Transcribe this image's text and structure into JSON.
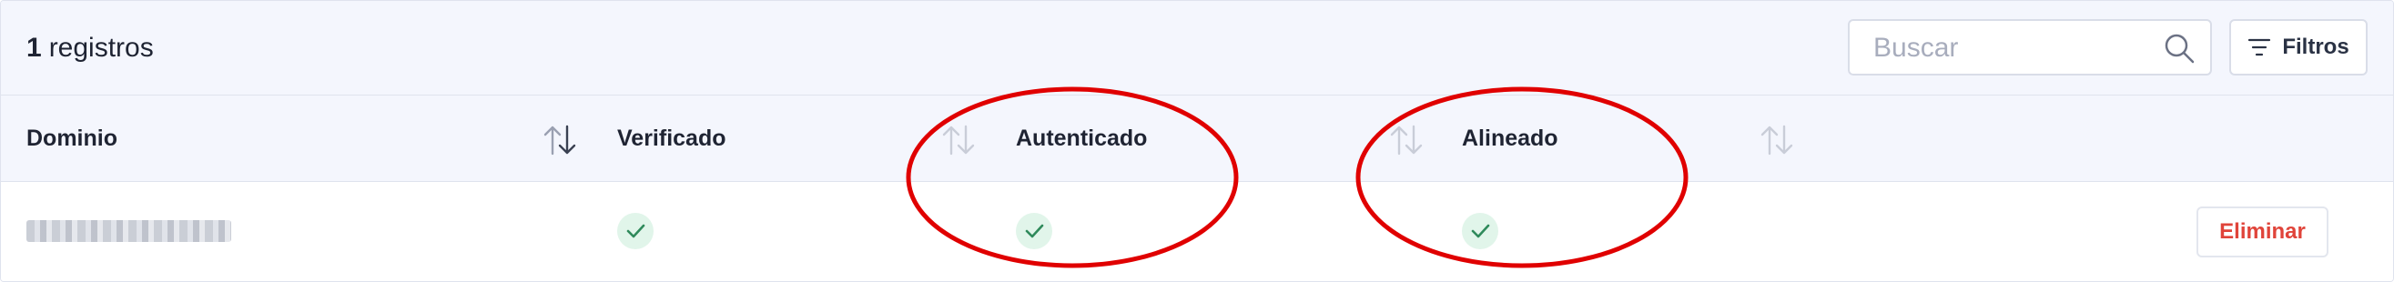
{
  "toolbar": {
    "count_number": "1",
    "count_label": "registros",
    "search_placeholder": "Buscar",
    "filters_label": "Filtros"
  },
  "columns": [
    "Dominio",
    "Verificado",
    "Autenticado",
    "Alineado"
  ],
  "rows": [
    {
      "domain": "",
      "verified": true,
      "authenticated": true,
      "aligned": true,
      "action_label": "Eliminar"
    }
  ],
  "icons": {
    "search": "search-icon",
    "filter": "filter-icon",
    "sort": "sort-arrows-icon",
    "check": "check-icon"
  },
  "colors": {
    "toolbar_bg": "#f4f6fd",
    "check_bg": "#e1f5ea",
    "check_stroke": "#2f8a5b",
    "danger": "#e0443a",
    "annotation": "#e00000"
  }
}
